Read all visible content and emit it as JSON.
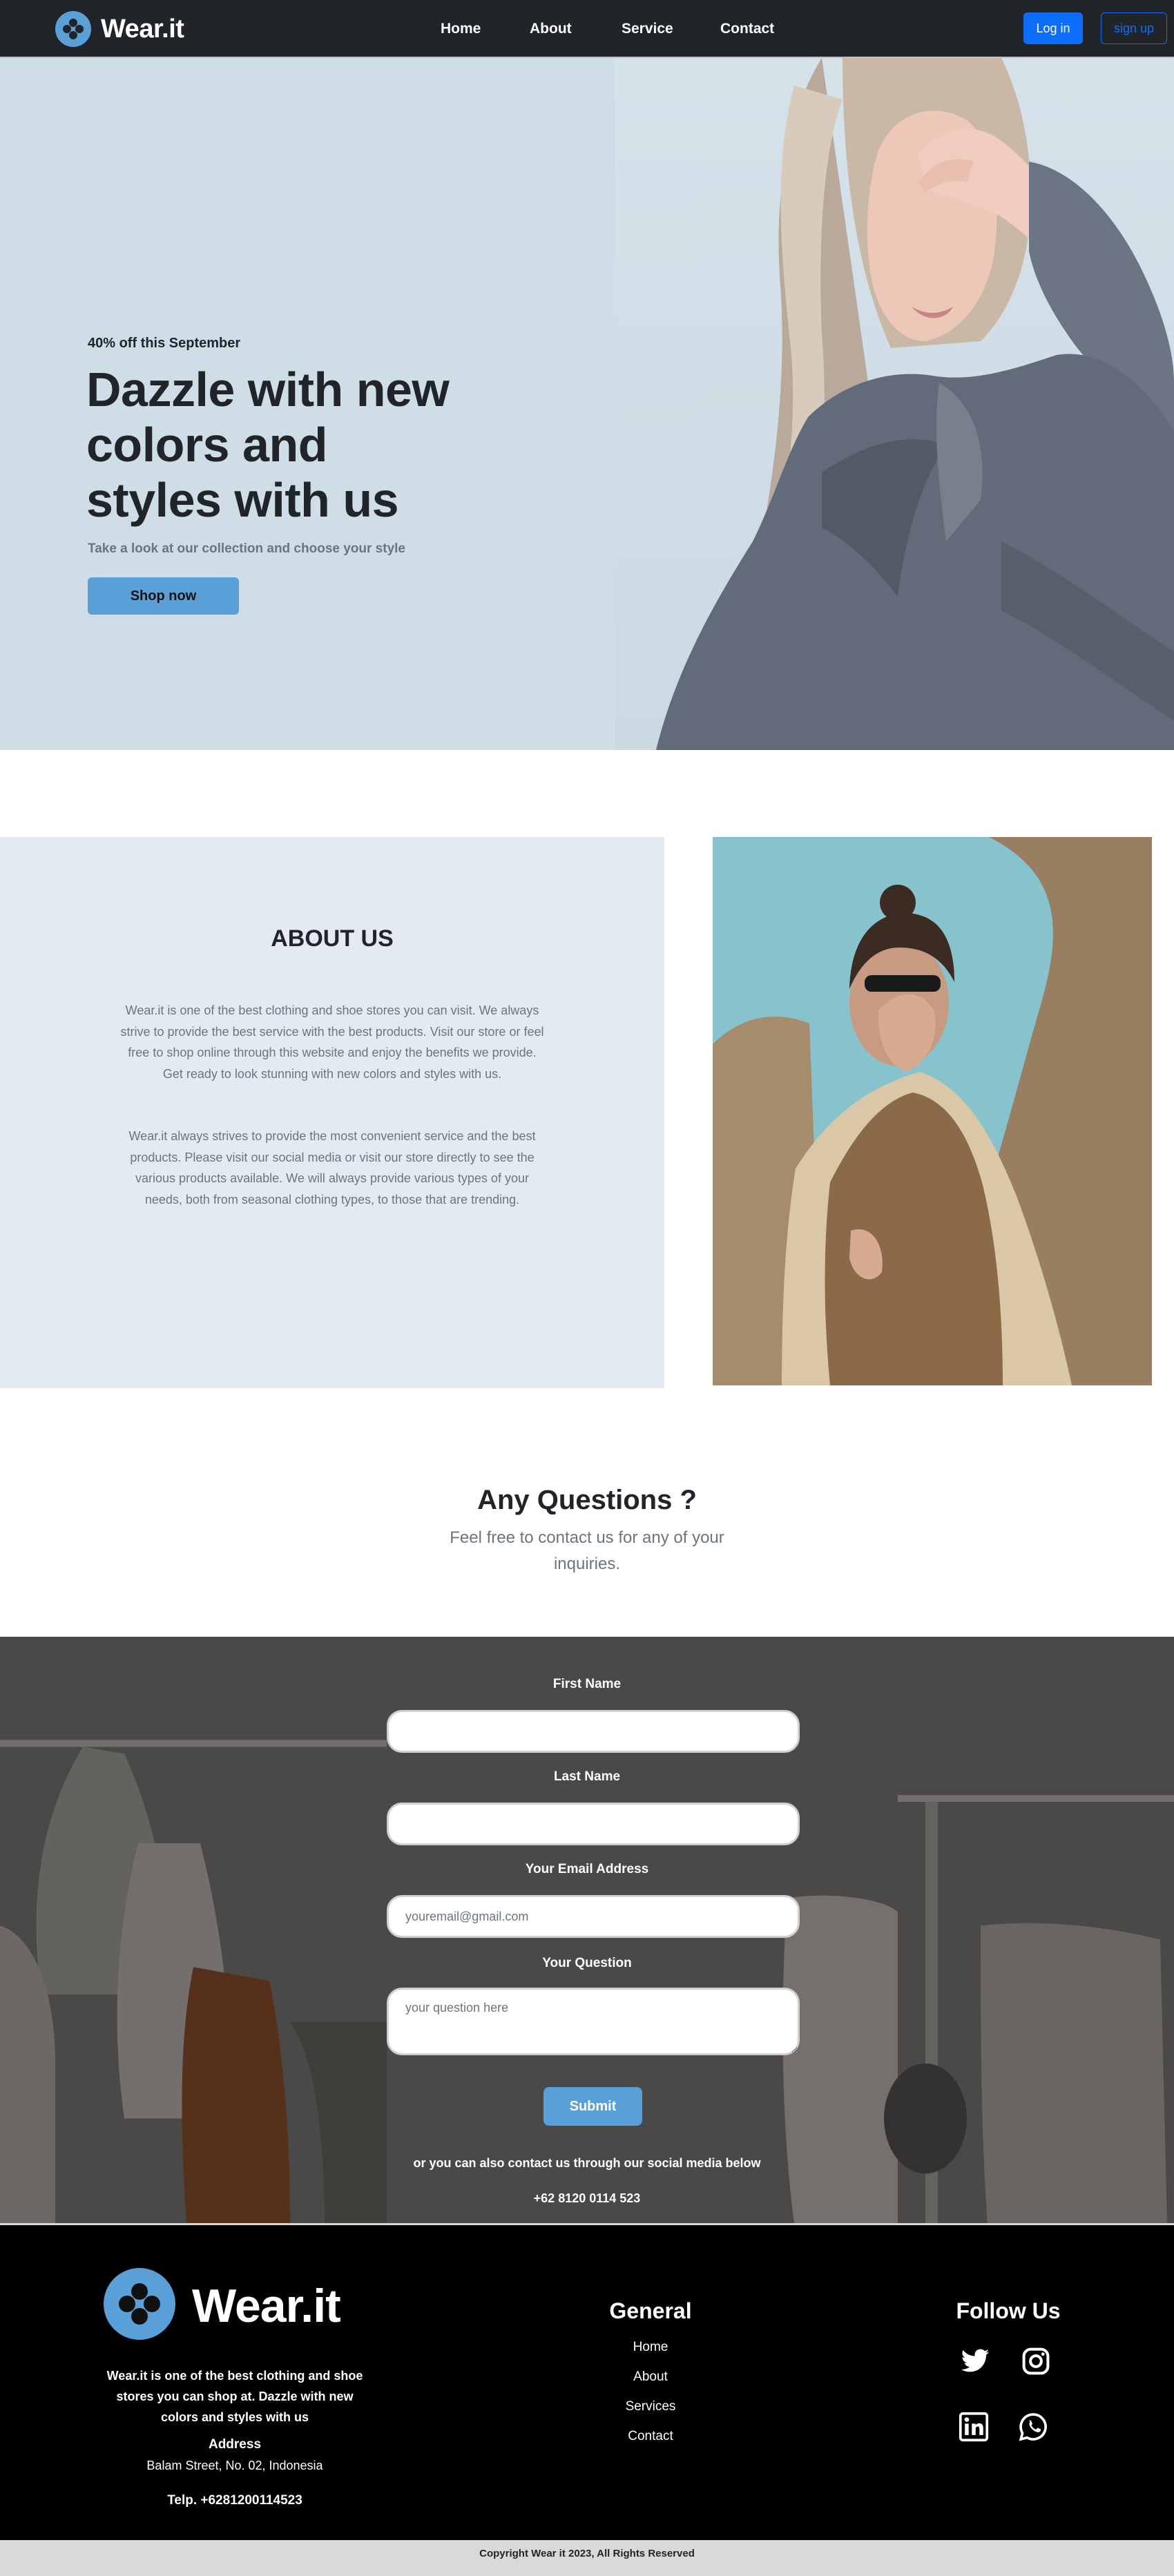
{
  "nav": {
    "brand": "Wear.it",
    "links": [
      "Home",
      "About",
      "Service",
      "Contact"
    ],
    "login": "Log in",
    "signup": "sign up"
  },
  "hero": {
    "tag": "40% off this September",
    "title": "Dazzle with new colors and styles with us",
    "subtitle": "Take a look at our collection and choose your style",
    "cta": "Shop now"
  },
  "about": {
    "heading": "ABOUT US",
    "p1": "Wear.it is one of the best clothing and shoe stores you can visit. We always strive to provide the best service with the best products. Visit our store or feel free to shop online through this website and enjoy the benefits we provide. Get ready to look stunning with new colors and styles with us.",
    "p2": "Wear.it always strives to provide the most convenient service and the best products. Please visit our social media or visit our store directly to see the various products available. We will always provide various types of your needs, both from seasonal clothing types, to those that are trending."
  },
  "questions": {
    "title": "Any Questions ?",
    "subtitle": "Feel free to contact us for any of your inquiries."
  },
  "form": {
    "first_name_label": "First Name",
    "last_name_label": "Last Name",
    "email_label": "Your Email Address",
    "email_placeholder": "youremail@gmail.com",
    "question_label": "Your Question",
    "question_placeholder": "your question here",
    "submit": "Submit",
    "note": "or you can also contact us through our social media below",
    "phone": "+62 8120 0114 523"
  },
  "footer": {
    "brand": "Wear.it",
    "description": "Wear.it is one of the best clothing and shoe stores you can shop at. Dazzle with new colors and styles with us",
    "address_label": "Address",
    "address": "Balam Street, No. 02, Indonesia",
    "tel": "Telp. +6281200114523",
    "general_heading": "General",
    "general_links": [
      "Home",
      "About",
      "Services",
      "Contact"
    ],
    "follow_heading": "Follow Us",
    "social_icons": [
      "twitter-icon",
      "instagram-icon",
      "linkedin-icon",
      "whatsapp-icon"
    ],
    "copyright": "Copyright Wear it 2023, All Rights Reserved"
  },
  "colors": {
    "navbar_bg": "#212529",
    "accent_blue": "#0d6efd",
    "button_blue": "#5aa0d8",
    "hero_bg": "#cfdde6",
    "about_bg": "#e4eaf1",
    "footer_bg": "#000000"
  }
}
